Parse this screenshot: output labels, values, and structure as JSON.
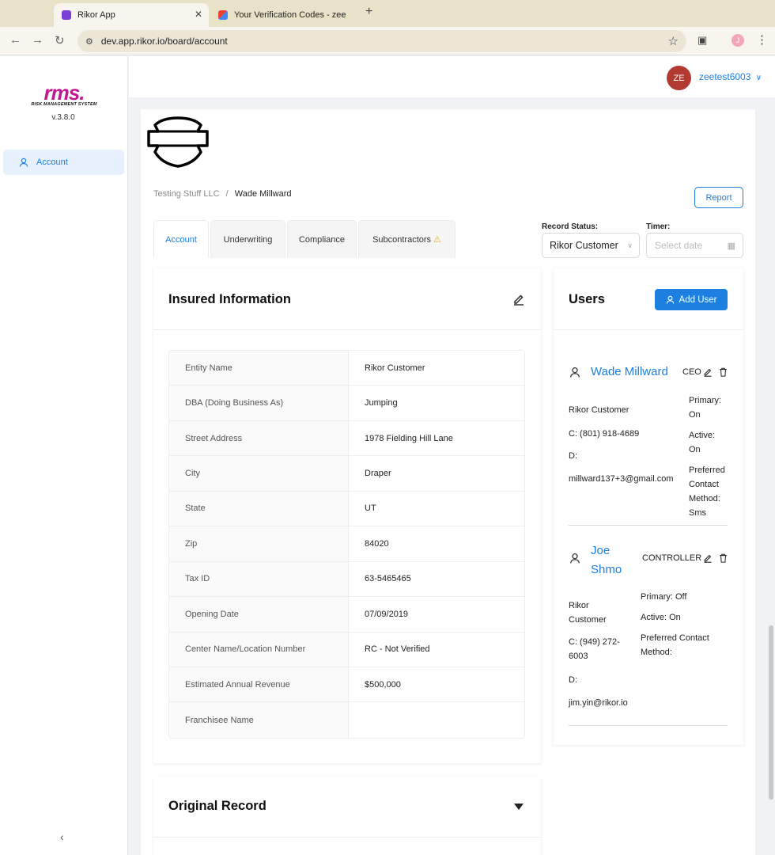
{
  "browser": {
    "tabs": [
      {
        "title": "Rikor App",
        "active": true
      },
      {
        "title": "Your Verification Codes - zee",
        "active": false
      }
    ],
    "url": "dev.app.rikor.io/board/account",
    "profile_initial": "J"
  },
  "sidebar": {
    "logo_text": "rms.",
    "logo_subtitle": "RISK MANAGEMENT SYSTEM",
    "version": "v.3.8.0",
    "items": [
      {
        "label": "Account",
        "icon": "user-icon",
        "active": true
      }
    ],
    "collapse_icon": "chevron-left-icon"
  },
  "header": {
    "avatar_initials": "ZE",
    "username": "zeetest6003"
  },
  "breadcrumb": {
    "parent": "Testing Stuff LLC",
    "separator": "/",
    "current": "Wade Millward"
  },
  "report_button": "Report",
  "tabs": [
    "Account",
    "Underwriting",
    "Compliance",
    "Subcontractors"
  ],
  "record_status": {
    "label": "Record Status:",
    "value": "Rikor Customer"
  },
  "timer": {
    "label": "Timer:",
    "placeholder": "Select date"
  },
  "insured": {
    "title": "Insured Information",
    "rows": [
      {
        "label": "Entity Name",
        "value": "Rikor Customer"
      },
      {
        "label": "DBA (Doing Business As)",
        "value": "Jumping"
      },
      {
        "label": "Street Address",
        "value": "1978 Fielding Hill Lane"
      },
      {
        "label": "City",
        "value": "Draper"
      },
      {
        "label": "State",
        "value": "UT"
      },
      {
        "label": "Zip",
        "value": "84020"
      },
      {
        "label": "Tax ID",
        "value": "63-5465465"
      },
      {
        "label": "Opening Date",
        "value": "07/09/2019"
      },
      {
        "label": "Center Name/Location Number",
        "value": "RC - Not Verified"
      },
      {
        "label": "Estimated Annual Revenue",
        "value": "$500,000"
      },
      {
        "label": "Franchisee Name",
        "value": ""
      }
    ]
  },
  "users": {
    "title": "Users",
    "add_label": "Add User",
    "list": [
      {
        "name": "Wade Millward",
        "role": "CEO",
        "company": "Rikor Customer",
        "phone": "C: (801) 918-4689",
        "d": "D:",
        "email": "millward137+3@gmail.com",
        "primary_label": "Primary:",
        "primary_value": "On",
        "active_label": "Active:",
        "active_value": "On",
        "pref_label_1": "Preferred",
        "pref_label_2": "Contact",
        "pref_label_3": "Method:",
        "pref_value": "Sms"
      },
      {
        "name_line1": "Joe",
        "name_line2": "Shmo",
        "role": "CONTROLLER",
        "company_line1": "Rikor",
        "company_line2": "Customer",
        "phone_line1": "C: (949) 272-",
        "phone_line2": "6003",
        "d": "D:",
        "email": "jim.yin@rikor.io",
        "primary": "Primary: Off",
        "active": "Active: On",
        "pref_line1": "Preferred Contact",
        "pref_line2": "Method:"
      }
    ]
  },
  "original_record": {
    "title": "Original Record"
  },
  "colors": {
    "accent": "#1d7fe0",
    "avatar": "#b33a30",
    "brand": "#c2188f",
    "warning": "#e8b020"
  }
}
